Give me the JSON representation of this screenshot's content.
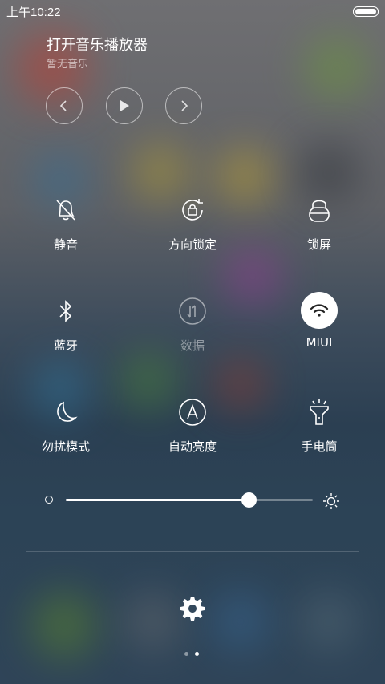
{
  "status_bar": {
    "time": "上午10:22"
  },
  "music": {
    "title": "打开音乐播放器",
    "subtitle": "暂无音乐"
  },
  "tiles": [
    {
      "label": "静音",
      "icon": "bell-off-icon",
      "active": false,
      "enabled": true
    },
    {
      "label": "方向锁定",
      "icon": "rotation-lock-icon",
      "active": false,
      "enabled": true
    },
    {
      "label": "锁屏",
      "icon": "lock-icon",
      "active": false,
      "enabled": true
    },
    {
      "label": "蓝牙",
      "icon": "bluetooth-icon",
      "active": false,
      "enabled": true
    },
    {
      "label": "数据",
      "icon": "mobile-data-icon",
      "active": false,
      "enabled": false
    },
    {
      "label": "MIUI",
      "icon": "wifi-icon",
      "active": true,
      "enabled": true
    },
    {
      "label": "勿扰模式",
      "icon": "moon-icon",
      "active": false,
      "enabled": true
    },
    {
      "label": "自动亮度",
      "icon": "auto-brightness-icon",
      "active": false,
      "enabled": true
    },
    {
      "label": "手电筒",
      "icon": "flashlight-icon",
      "active": false,
      "enabled": true
    }
  ],
  "brightness": {
    "level": 0.74
  },
  "pager": {
    "count": 2,
    "current": 1
  },
  "colors": {
    "accent": "#ffffff",
    "active_icon_fg": "#222222"
  }
}
